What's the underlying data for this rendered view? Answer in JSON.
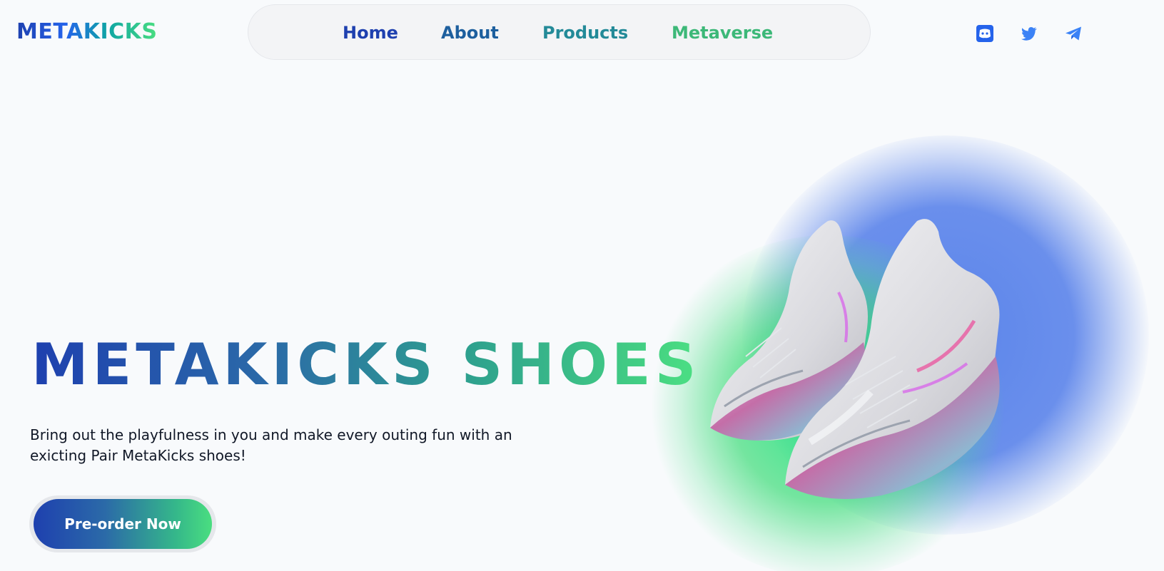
{
  "brand": {
    "logo_text": "METAKICKS"
  },
  "nav": {
    "items": [
      {
        "label": "Home",
        "color": "#1e40af"
      },
      {
        "label": "About",
        "color": "#1d5f9e"
      },
      {
        "label": "Products",
        "color": "#238a98"
      },
      {
        "label": "Metaverse",
        "color": "#3cb878"
      }
    ]
  },
  "socials": [
    {
      "icon": "discord-icon"
    },
    {
      "icon": "twitter-icon"
    },
    {
      "icon": "telegram-icon"
    }
  ],
  "hero": {
    "title": "METAKICKS SHOES",
    "subtitle": "Bring out the playfulness in you and make every outing fun with an exicting Pair MetaKicks shoes!",
    "cta_label": "Pre-order Now",
    "image_name": "sneakers-image"
  },
  "colors": {
    "gradient_start": "#1e40af",
    "gradient_end": "#4ade80",
    "background": "#f8fafc"
  }
}
